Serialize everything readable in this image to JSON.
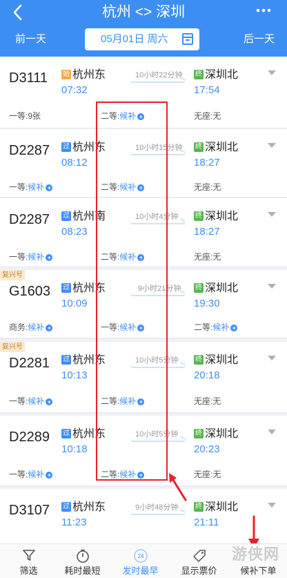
{
  "header": {
    "back_icon": "back-arrow-icon",
    "title": "杭州 <> 深圳",
    "more_icon": "more-dots-icon",
    "prev_day": "前一天",
    "next_day": "后一天",
    "date": "05月01日 周六",
    "calendar_icon": "calendar-icon"
  },
  "trains": [
    {
      "no": "D3111",
      "badge": "",
      "dep_tag": "始",
      "dep_station": "杭州东",
      "dep_time": "07:32",
      "duration": "10小时22分钟",
      "arr_tag": "终",
      "arr_station": "深圳北",
      "arr_time": "17:54",
      "seats": [
        {
          "label": "一等:",
          "value": "9张",
          "houbu": false
        },
        {
          "label": "二等:",
          "value": "候补",
          "houbu": true
        },
        {
          "label": "无座:",
          "value": "无",
          "houbu": false
        }
      ]
    },
    {
      "no": "D2287",
      "badge": "",
      "dep_tag": "过",
      "dep_station": "杭州东",
      "dep_time": "08:12",
      "duration": "10小时15分钟",
      "arr_tag": "终",
      "arr_station": "深圳北",
      "arr_time": "18:27",
      "seats": [
        {
          "label": "一等:",
          "value": "候补",
          "houbu": true
        },
        {
          "label": "二等:",
          "value": "候补",
          "houbu": true
        },
        {
          "label": "无座:",
          "value": "无",
          "houbu": false
        }
      ]
    },
    {
      "no": "D2287",
      "badge": "",
      "dep_tag": "过",
      "dep_station": "杭州南",
      "dep_time": "08:23",
      "duration": "10小时4分钟",
      "arr_tag": "终",
      "arr_station": "深圳北",
      "arr_time": "18:27",
      "seats": [
        {
          "label": "一等:",
          "value": "候补",
          "houbu": true
        },
        {
          "label": "二等:",
          "value": "候补",
          "houbu": true
        },
        {
          "label": "无座:",
          "value": "无",
          "houbu": false
        }
      ]
    },
    {
      "no": "G1603",
      "badge": "复兴号",
      "dep_tag": "过",
      "dep_station": "杭州东",
      "dep_time": "10:09",
      "duration": "9小时21分钟",
      "arr_tag": "终",
      "arr_station": "深圳北",
      "arr_time": "19:30",
      "seats": [
        {
          "label": "商务:",
          "value": "候补",
          "houbu": true
        },
        {
          "label": "一等:",
          "value": "候补",
          "houbu": true
        },
        {
          "label": "二等:",
          "value": "候补",
          "houbu": true
        }
      ]
    },
    {
      "no": "D2281",
      "badge": "复兴号",
      "dep_tag": "过",
      "dep_station": "杭州东",
      "dep_time": "10:13",
      "duration": "10小时5分钟",
      "arr_tag": "终",
      "arr_station": "深圳北",
      "arr_time": "20:18",
      "seats": [
        {
          "label": "一等:",
          "value": "候补",
          "houbu": true
        },
        {
          "label": "二等:",
          "value": "候补",
          "houbu": true
        },
        {
          "label": "无座:",
          "value": "无",
          "houbu": false
        }
      ]
    },
    {
      "no": "D2289",
      "badge": "",
      "dep_tag": "过",
      "dep_station": "杭州东",
      "dep_time": "10:18",
      "duration": "10小时5分钟",
      "arr_tag": "终",
      "arr_station": "深圳北",
      "arr_time": "20:23",
      "seats": [
        {
          "label": "一等:",
          "value": "候补",
          "houbu": true
        },
        {
          "label": "二等:",
          "value": "候补",
          "houbu": true
        },
        {
          "label": "无座:",
          "value": "无",
          "houbu": false
        }
      ]
    },
    {
      "no": "D3107",
      "badge": "",
      "dep_tag": "过",
      "dep_station": "杭州东",
      "dep_time": "11:23",
      "duration": "9小时48分钟",
      "arr_tag": "终",
      "arr_station": "深圳北",
      "arr_time": "21:11",
      "seats": []
    }
  ],
  "tabbar": [
    {
      "label": "筛选",
      "icon": "filter-icon"
    },
    {
      "label": "耗时最短",
      "icon": "stopwatch-icon"
    },
    {
      "label": "发时最早",
      "icon": "clock-24-icon"
    },
    {
      "label": "显示票价",
      "icon": "price-tag-icon"
    },
    {
      "label": "候补下单",
      "icon": "houbu-order-icon"
    }
  ],
  "watermark": "游侠网",
  "colors": {
    "primary": "#3d8ef3",
    "highlight": "#e8202a",
    "fuxing_badge": "#fde9cf"
  }
}
